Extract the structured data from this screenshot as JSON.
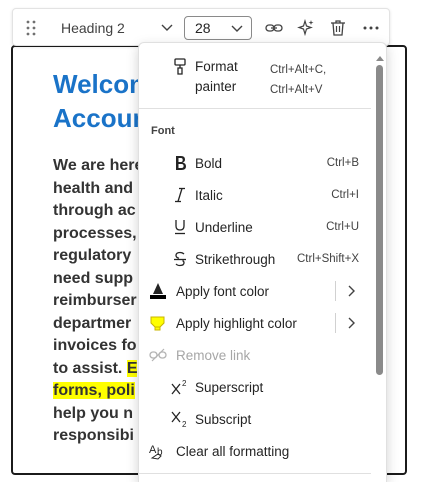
{
  "toolbar": {
    "style_value": "Heading 2",
    "font_size": "28"
  },
  "document": {
    "heading": "Welcome\nAccount",
    "body_lines": [
      "We are here",
      "health and",
      "through ac",
      "processes,",
      "regulatory",
      "need supp",
      "reimburser",
      "departmer",
      "invoices fo",
      "to assist.",
      "forms, poli",
      "help you n",
      "responsibi"
    ],
    "highlight_fragment_1": "E",
    "highlight_color": "#ffff00",
    "heading_color": "#1a73c8"
  },
  "menu": {
    "format_painter": {
      "label": "Format\npainter",
      "shortcut": "Ctrl+Alt+C,\nCtrl+Alt+V"
    },
    "section_font": "Font",
    "items": [
      {
        "label": "Bold",
        "shortcut": "Ctrl+B",
        "icon": "bold-icon"
      },
      {
        "label": "Italic",
        "shortcut": "Ctrl+I",
        "icon": "italic-icon"
      },
      {
        "label": "Underline",
        "shortcut": "Ctrl+U",
        "icon": "underline-icon"
      },
      {
        "label": "Strikethrough",
        "shortcut": "Ctrl+Shift+X",
        "icon": "strikethrough-icon"
      }
    ],
    "apply_font_color": "Apply font color",
    "apply_highlight_color": "Apply highlight color",
    "remove_link": "Remove link",
    "superscript": "Superscript",
    "subscript": "Subscript",
    "clear_formatting": "Clear all formatting",
    "font_color_swatch": "#000000",
    "highlight_swatch": "#ffff00"
  }
}
